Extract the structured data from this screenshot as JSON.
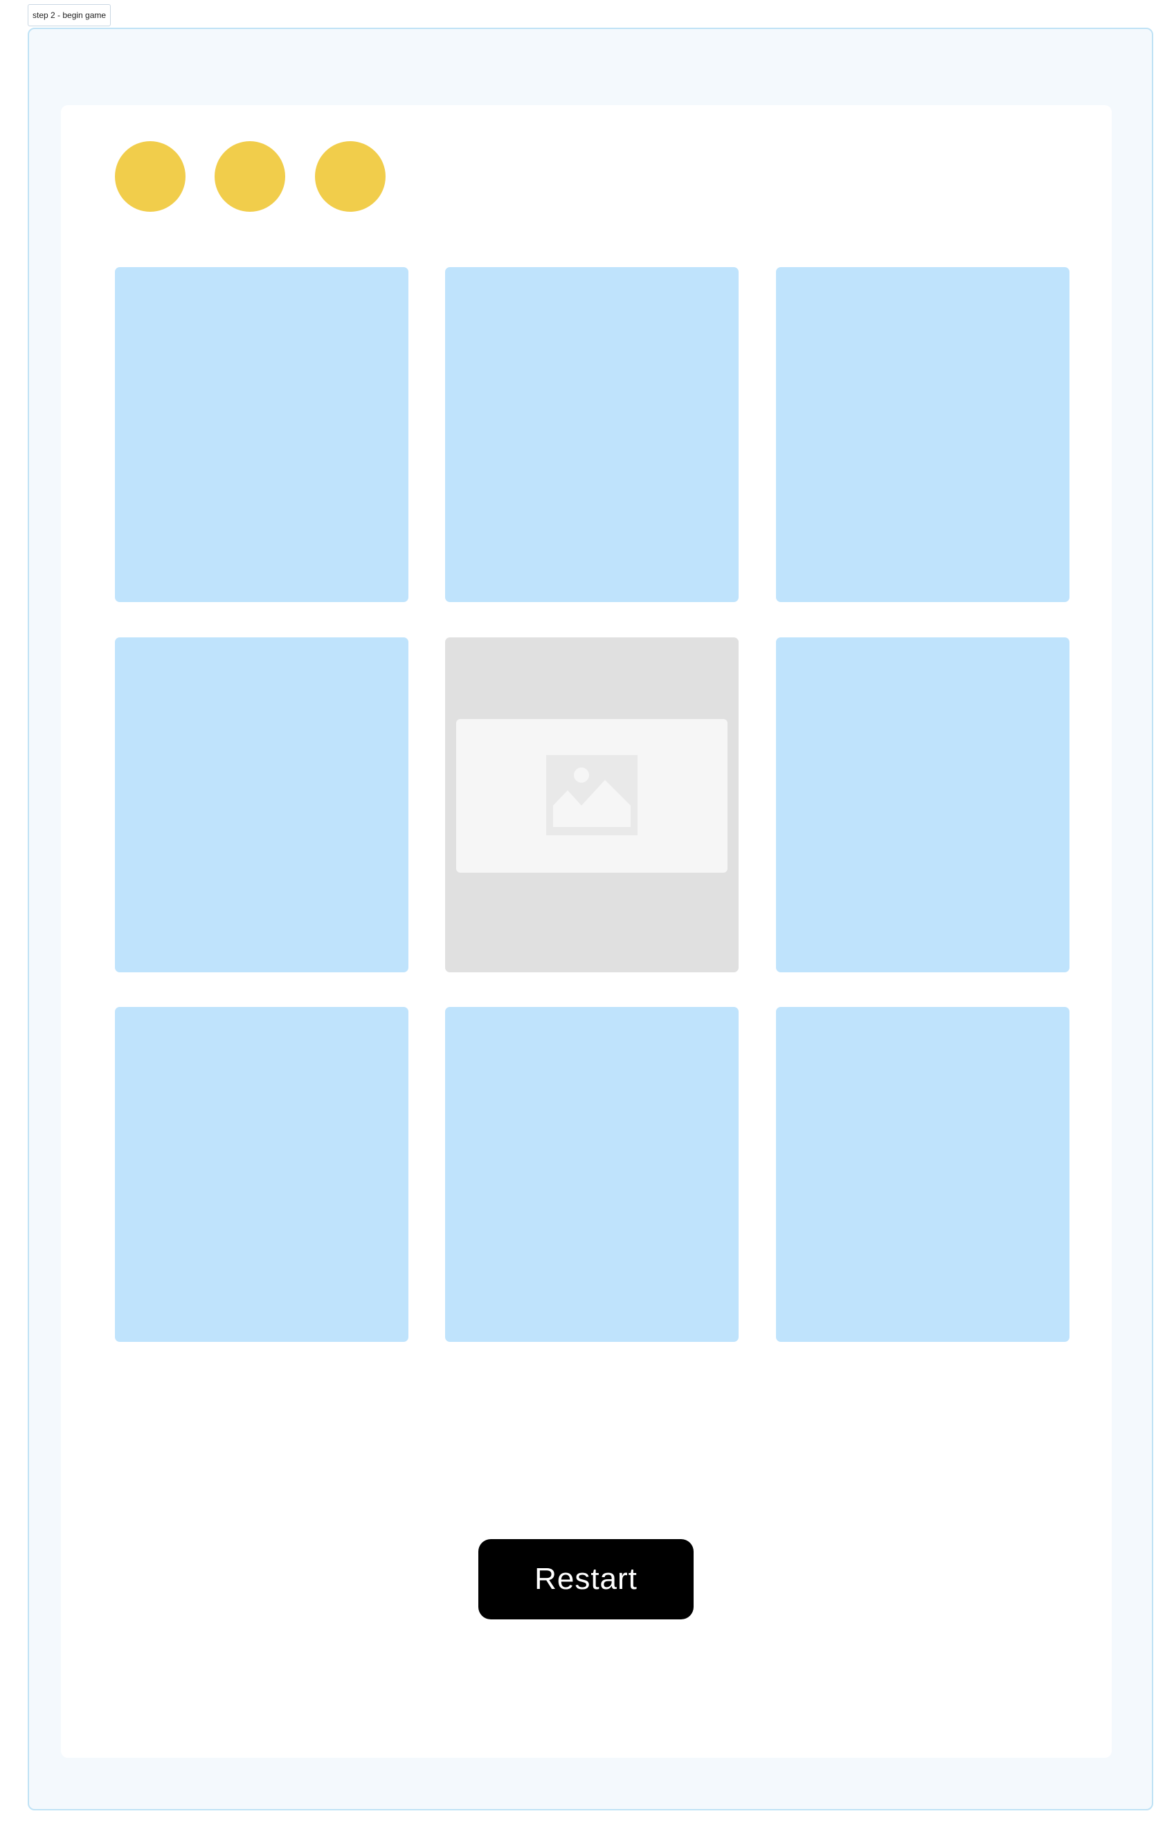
{
  "frame": {
    "label": "step 2 - begin game"
  },
  "game": {
    "lives": 3,
    "board": {
      "rows": 3,
      "columns": 3,
      "cards": [
        {
          "state": "face-down"
        },
        {
          "state": "face-down"
        },
        {
          "state": "face-down"
        },
        {
          "state": "face-down"
        },
        {
          "state": "revealed",
          "content_icon": "image-placeholder-icon"
        },
        {
          "state": "face-down"
        },
        {
          "state": "face-down"
        },
        {
          "state": "face-down"
        },
        {
          "state": "face-down"
        }
      ]
    },
    "restart_label": "Restart"
  },
  "colors": {
    "frame_background": "#f4f9fd",
    "frame_border": "#bfe2f5",
    "life_token": "#f1cd4b",
    "card_back": "#bfe3fc",
    "card_revealed": "#e0e0e0",
    "image_placeholder": "#f6f6f6",
    "button_background": "#000000",
    "button_text": "#ffffff"
  }
}
